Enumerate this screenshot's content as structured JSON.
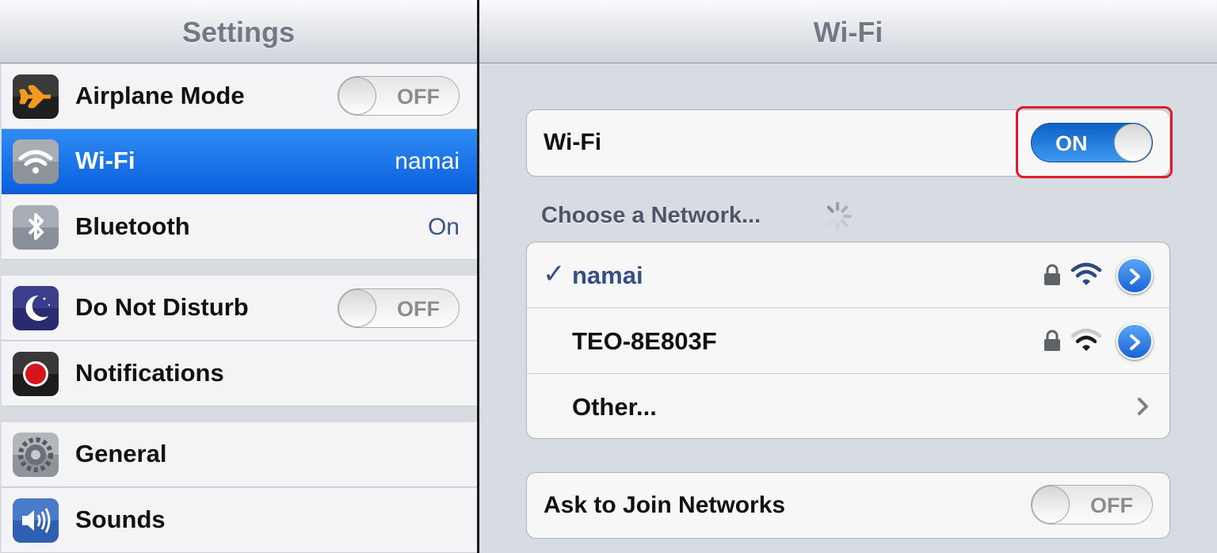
{
  "colors": {
    "selection_blue": "#0a5fdc",
    "switch_on_blue": "#1a7de6",
    "value_blue": "#385487",
    "highlight_red": "#e0192a"
  },
  "master": {
    "title": "Settings",
    "items": [
      {
        "label": "Airplane Mode",
        "icon": "airplane-icon",
        "switch": "OFF"
      },
      {
        "label": "Wi-Fi",
        "icon": "wifi-icon",
        "value": "namai",
        "selected": true
      },
      {
        "label": "Bluetooth",
        "icon": "bluetooth-icon",
        "value": "On"
      },
      {
        "label": "Do Not Disturb",
        "icon": "moon-icon",
        "switch": "OFF"
      },
      {
        "label": "Notifications",
        "icon": "notifications-icon"
      },
      {
        "label": "General",
        "icon": "gear-icon"
      },
      {
        "label": "Sounds",
        "icon": "speaker-icon"
      }
    ]
  },
  "detail": {
    "title": "Wi-Fi",
    "wifi_toggle": {
      "label": "Wi-Fi",
      "state": "ON"
    },
    "section_header": "Choose a Network...",
    "networks": [
      {
        "name": "namai",
        "joined": true,
        "checkmark": "✓",
        "secured": true,
        "signal_bars": 3
      },
      {
        "name": "TEO-8E803F",
        "joined": false,
        "secured": true,
        "signal_bars": 2
      }
    ],
    "other": {
      "label": "Other..."
    },
    "ask_to_join": {
      "label": "Ask to Join Networks",
      "state": "OFF"
    }
  }
}
